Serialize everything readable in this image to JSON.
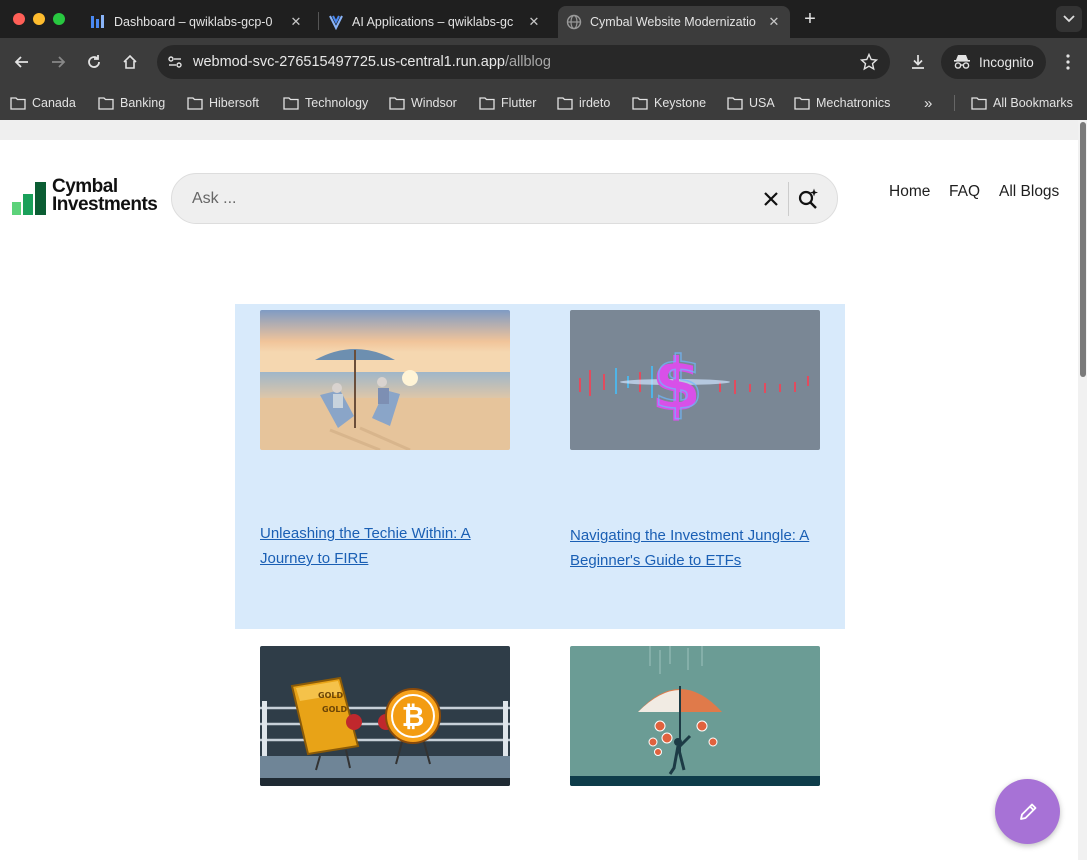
{
  "browser": {
    "tabs": [
      {
        "title": "Dashboard – qwiklabs-gcp-0",
        "active": false
      },
      {
        "title": "AI Applications – qwiklabs-gc",
        "active": false
      },
      {
        "title": "Cymbal Website Modernizatio",
        "active": true
      }
    ],
    "url": {
      "host": "webmod-svc-276515497725.us-central1.run.app",
      "path": "/allblog"
    },
    "profile_label": "Incognito",
    "bookmarks": [
      "Canada",
      "Banking",
      "Hibersoft",
      "Technology",
      "Windsor",
      "Flutter",
      "irdeto",
      "Keystone",
      "USA",
      "Mechatronics"
    ],
    "all_bookmarks_label": "All Bookmarks",
    "overflow_label": "»"
  },
  "site": {
    "logo": {
      "line1": "Cymbal",
      "line2": "Investments"
    },
    "search": {
      "placeholder": "Ask ...",
      "value": ""
    },
    "nav": [
      "Home",
      "FAQ",
      "All Blogs"
    ]
  },
  "blogs": [
    {
      "title": "Unleashing the Techie Within: A Journey to FIRE",
      "image": "beach-retirement-image"
    },
    {
      "title": "Navigating the Investment Jungle: A Beginner's Guide to ETFs",
      "image": "dollar-sign-chart-image"
    },
    {
      "title": "",
      "image": "gold-vs-bitcoin-image"
    },
    {
      "title": "",
      "image": "umbrella-coins-image"
    }
  ],
  "colors": {
    "accent": "#a772d6",
    "featured_bg": "#d8eafb",
    "link": "#1a5fb4",
    "logo_green": "#1aa05a"
  }
}
